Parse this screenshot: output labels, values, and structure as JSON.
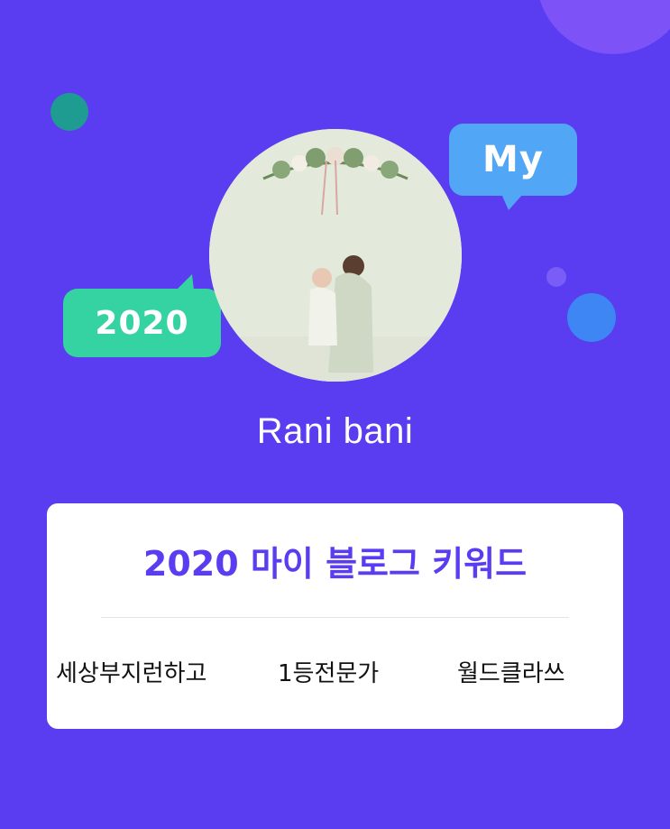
{
  "bubbles": {
    "my_label": "My",
    "year_label": "2020"
  },
  "profile": {
    "name": "Rani bani"
  },
  "card": {
    "title": "2020 마이 블로그 키워드",
    "keywords": [
      "세상부지런하고",
      "1등전문가",
      "월드클라쓰"
    ]
  },
  "colors": {
    "background": "#5a3df0",
    "card_title": "#5a3df0",
    "my_bubble": "#52a6f6",
    "year_bubble": "#35d2a2",
    "teal_dot": "#1e9c91",
    "blue_dot": "#3d86f3"
  }
}
